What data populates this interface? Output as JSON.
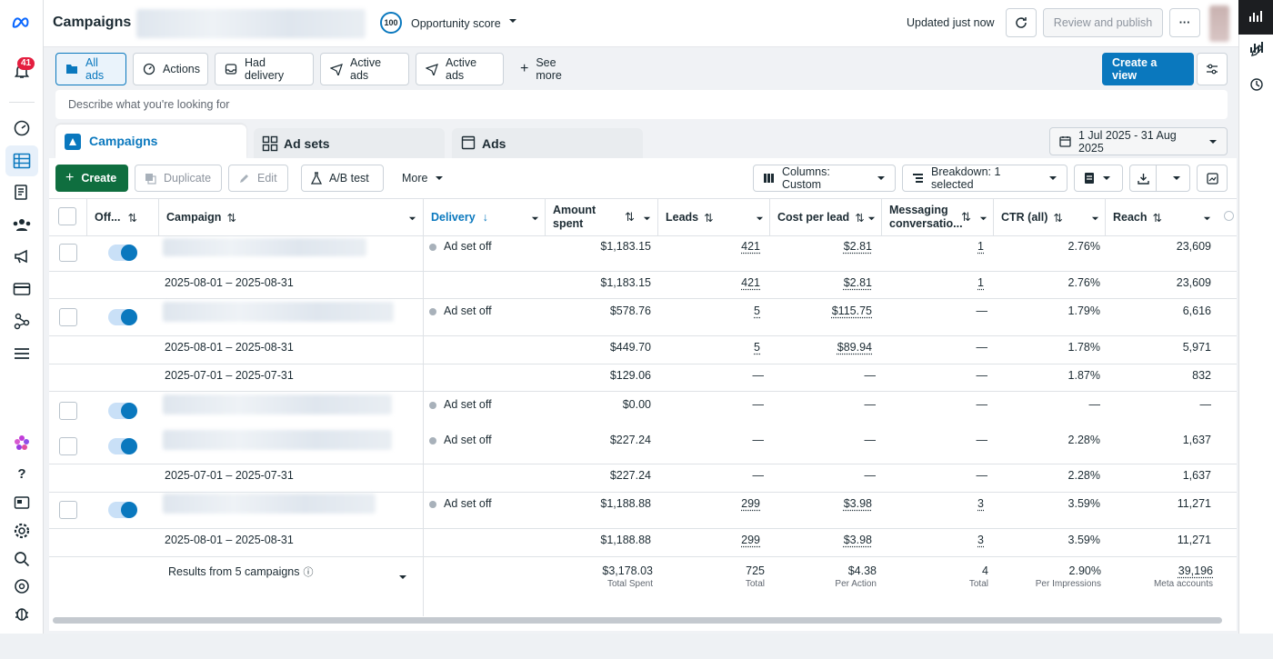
{
  "header": {
    "title": "Campaigns",
    "opportunity_score_value": "100",
    "opportunity_score_label": "Opportunity score",
    "updated_text": "Updated just now",
    "review_publish": "Review and publish",
    "notif_count": "41"
  },
  "filters": {
    "items": [
      "All ads",
      "Actions",
      "Had delivery",
      "Active ads",
      "Active ads"
    ],
    "see_more": "See more",
    "create_view": "Create a view",
    "search_placeholder": "Describe what you're looking for"
  },
  "tabs": {
    "campaigns": "Campaigns",
    "adsets": "Ad sets",
    "ads": "Ads"
  },
  "date_range": "1 Jul 2025 - 31 Aug 2025",
  "toolbar": {
    "create": "Create",
    "duplicate": "Duplicate",
    "edit": "Edit",
    "ab_test": "A/B test",
    "more": "More",
    "columns": "Columns: Custom",
    "breakdown": "Breakdown: 1 selected"
  },
  "columns": {
    "offon": "Off...",
    "campaign": "Campaign",
    "delivery": "Delivery",
    "amount_spent_1": "Amount",
    "amount_spent_2": "spent",
    "leads": "Leads",
    "cost_per_lead": "Cost per lead",
    "messaging_1": "Messaging",
    "messaging_2": "conversatio...",
    "ctr": "CTR (all)",
    "reach": "Reach"
  },
  "rows": [
    {
      "type": "campaign",
      "delivery": "Ad set off",
      "spent": "$1,183.15",
      "leads": "421",
      "cpl": "$2.81",
      "msg": "1",
      "ctr": "2.76%",
      "reach": "23,609"
    },
    {
      "type": "breakdown",
      "date": "2025-08-01 – 2025-08-31",
      "spent": "$1,183.15",
      "leads": "421",
      "cpl": "$2.81",
      "msg": "1",
      "ctr": "2.76%",
      "reach": "23,609"
    },
    {
      "type": "campaign",
      "delivery": "Ad set off",
      "spent": "$578.76",
      "leads": "5",
      "cpl": "$115.75",
      "msg": "—",
      "ctr": "1.79%",
      "reach": "6,616"
    },
    {
      "type": "breakdown",
      "date": "2025-08-01 – 2025-08-31",
      "spent": "$449.70",
      "leads": "5",
      "cpl": "$89.94",
      "msg": "—",
      "ctr": "1.78%",
      "reach": "5,971"
    },
    {
      "type": "breakdown",
      "date": "2025-07-01 – 2025-07-31",
      "spent": "$129.06",
      "leads": "—",
      "cpl": "—",
      "msg": "—",
      "ctr": "1.87%",
      "reach": "832"
    },
    {
      "type": "campaign",
      "delivery": "Ad set off",
      "spent": "$0.00",
      "leads": "—",
      "cpl": "—",
      "msg": "—",
      "ctr": "—",
      "reach": "—"
    },
    {
      "type": "campaign",
      "delivery": "Ad set off",
      "spent": "$227.24",
      "leads": "—",
      "cpl": "—",
      "msg": "—",
      "ctr": "2.28%",
      "reach": "1,637"
    },
    {
      "type": "breakdown",
      "date": "2025-07-01 – 2025-07-31",
      "spent": "$227.24",
      "leads": "—",
      "cpl": "—",
      "msg": "—",
      "ctr": "2.28%",
      "reach": "1,637"
    },
    {
      "type": "campaign",
      "delivery": "Ad set off",
      "spent": "$1,188.88",
      "leads": "299",
      "cpl": "$3.98",
      "msg": "3",
      "ctr": "3.59%",
      "reach": "11,271"
    },
    {
      "type": "breakdown",
      "date": "2025-08-01 – 2025-08-31",
      "spent": "$1,188.88",
      "leads": "299",
      "cpl": "$3.98",
      "msg": "3",
      "ctr": "3.59%",
      "reach": "11,271"
    }
  ],
  "totals": {
    "label": "Results from 5 campaigns",
    "spent": "$3,178.03",
    "spent_sub": "Total Spent",
    "leads": "725",
    "leads_sub": "Total",
    "cpl": "$4.38",
    "cpl_sub": "Per Action",
    "msg": "4",
    "msg_sub": "Total",
    "ctr": "2.90%",
    "ctr_sub": "Per Impressions",
    "reach": "39,196",
    "reach_sub": "Meta accounts"
  },
  "colors": {
    "accent": "#0a78be",
    "create_green": "#0f6e3f",
    "notif_red": "#e41e3f"
  }
}
